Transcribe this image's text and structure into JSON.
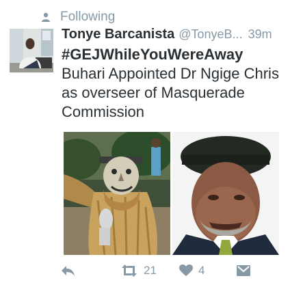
{
  "social_context": {
    "icon": "person-icon",
    "label": "Following"
  },
  "tweet": {
    "display_name": "Tonye Barcanista",
    "handle": "@TonyeB...",
    "time": "39m",
    "hashtag": "#GEJWhileYouWereAway",
    "text": "Buhari Appointed Dr Ngige Chris as overseer of Masquerade Commission"
  },
  "actions": {
    "reply": {
      "icon": "reply-icon"
    },
    "retweet": {
      "icon": "retweet-icon",
      "count": "21"
    },
    "like": {
      "icon": "heart-icon",
      "count": "4"
    },
    "message": {
      "icon": "message-icon"
    }
  },
  "colors": {
    "text": "#292f33",
    "muted": "#8899a6",
    "background": "#ffffff"
  }
}
